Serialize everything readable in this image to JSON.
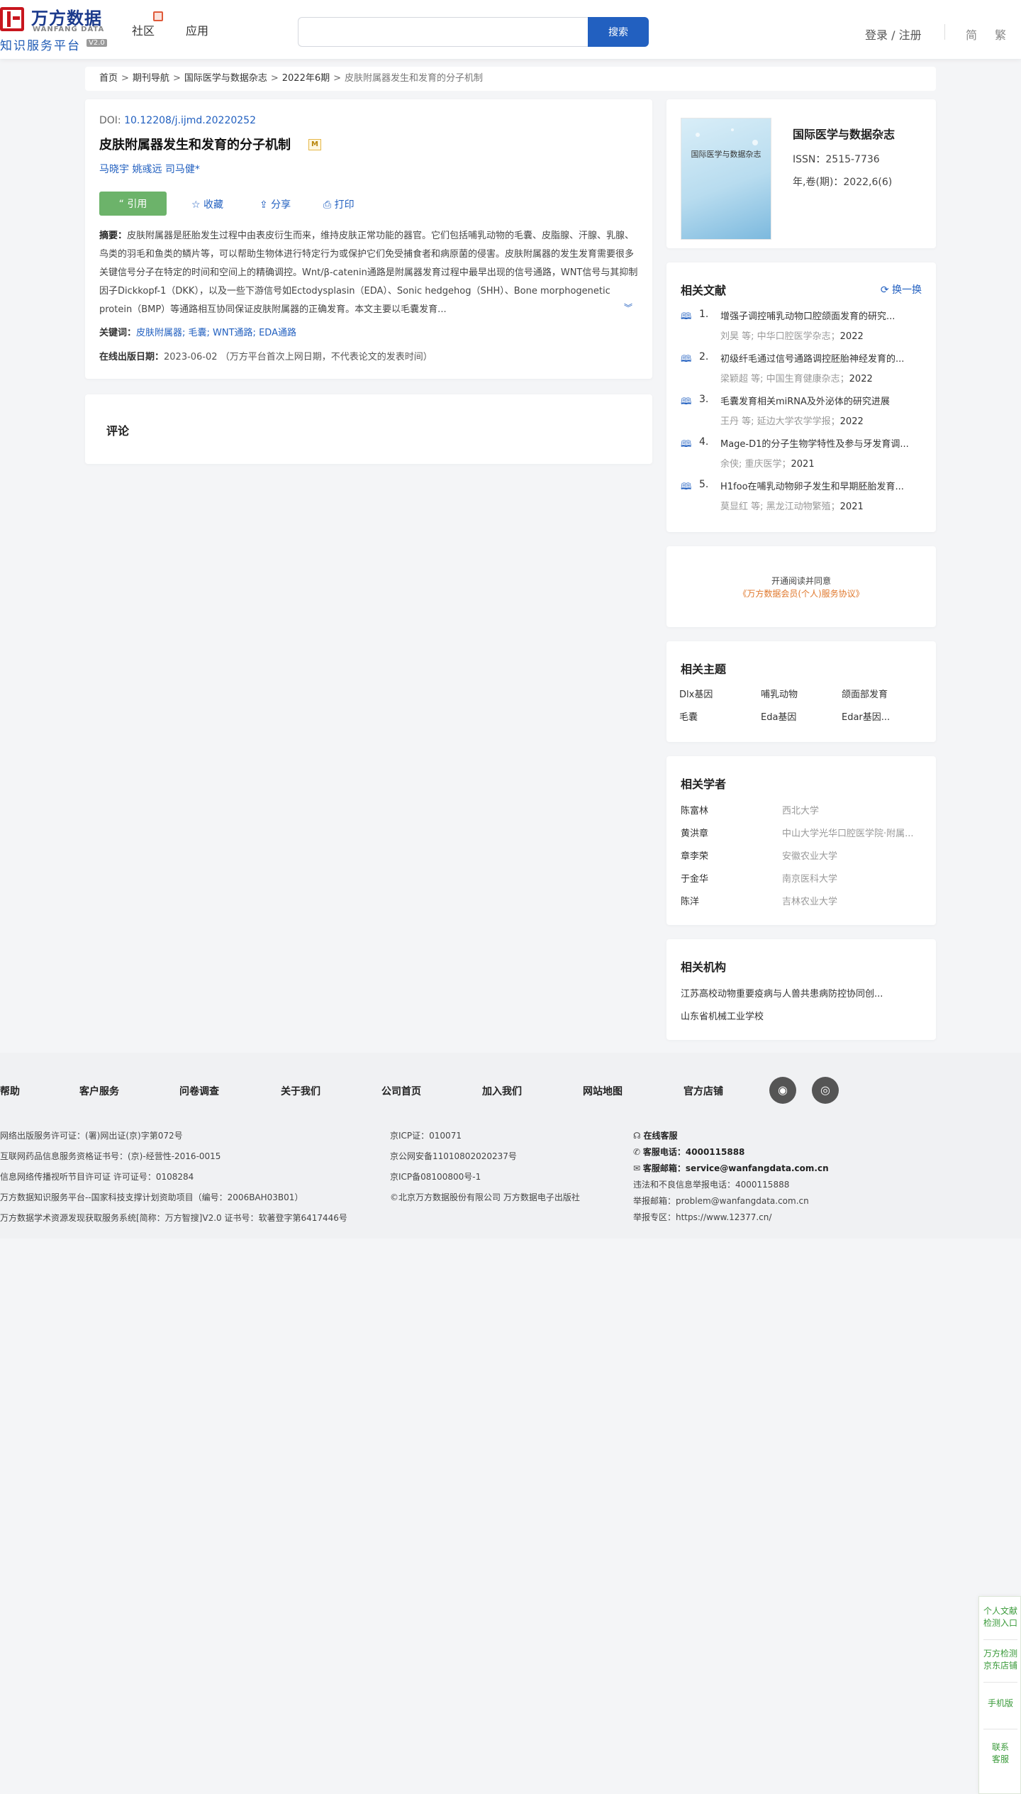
{
  "header": {
    "logo_cn": "万方数据",
    "logo_en": "WANFANG DATA",
    "logo_sub": "知识服务平台",
    "logo_version": "V2.0",
    "nav": [
      "社区",
      "应用"
    ],
    "search_placeholder": "",
    "search_button": "搜索",
    "login": "登录 / 注册",
    "lang_simplified": "简",
    "lang_traditional": "繁"
  },
  "breadcrumb": [
    "首页",
    "期刊导航",
    "国际医学与数据杂志",
    "2022年6期",
    "皮肤附属器发生和发育的分子机制"
  ],
  "article": {
    "doi_label": "DOI:",
    "doi": "10.12208/j.ijmd.20220252",
    "title": "皮肤附属器发生和发育的分子机制",
    "badge": "M",
    "authors": [
      "马晓宇",
      "姚彧远",
      "司马健*"
    ],
    "actions": {
      "cite": "“ 引用",
      "collect": "☆ 收藏",
      "share": "⇪ 分享",
      "print": "⎙ 打印"
    },
    "abstract_label": "摘要：",
    "abstract": "皮肤附属器是胚胎发生过程中由表皮衍生而来，维持皮肤正常功能的器官。它们包括哺乳动物的毛囊、皮脂腺、汗腺、乳腺、鸟类的羽毛和鱼类的鳞片等，可以帮助生物体进行特定行为或保护它们免受捕食者和病原菌的侵害。皮肤附属器的发生发育需要很多关键信号分子在特定的时间和空间上的精确调控。Wnt/β-catenin通路是附属器发育过程中最早出现的信号通路，WNT信号与其抑制因子Dickkopf-1（DKK），以及一些下游信号如Ectodysplasin（EDA）、Sonic hedgehog（SHH）、Bone morphogenetic protein（BMP）等通路相互协同保证皮肤附属器的正确发育。本文主要以毛囊发育...",
    "keywords_label": "关键词：",
    "keywords": "皮肤附属器; 毛囊; WNT通路; EDA通路",
    "pubdate_label": "在线出版日期：",
    "pubdate": "2023-06-02  （万方平台首次上网日期，不代表论文的发表时间）"
  },
  "comment": {
    "title": "评论"
  },
  "journal": {
    "cover_title": "国际医学与数据杂志",
    "name": "国际医学与数据杂志",
    "issn": "ISSN：2515-7736",
    "volume": "年,卷(期)：2022,6(6)"
  },
  "related_docs": {
    "title": "相关文献",
    "swap": "换一换",
    "items": [
      {
        "num": "1.",
        "title": "增强子调控哺乳动物口腔颌面发育的研究...",
        "authors": "刘昊  等;  中华口腔医学杂志；",
        "year": "2022"
      },
      {
        "num": "2.",
        "title": "初级纤毛通过信号通路调控胚胎神经发育的...",
        "authors": "梁颖超  等;  中国生育健康杂志；",
        "year": "2022"
      },
      {
        "num": "3.",
        "title": "毛囊发育相关miRNA及外泌体的研究进展",
        "authors": "王丹  等;  延边大学农学学报；",
        "year": "2022"
      },
      {
        "num": "4.",
        "title": "Mage-D1的分子生物学特性及参与牙发育调...",
        "authors": "余侠; 重庆医学；",
        "year": "2021"
      },
      {
        "num": "5.",
        "title": "H1foo在哺乳动物卵子发生和早期胚胎发育...",
        "authors": "莫显红  等;  黑龙江动物繁殖；",
        "year": "2021"
      }
    ]
  },
  "open_read": {
    "line1": "开通阅读并同意",
    "line2": "《万方数据会员(个人)服务协议》"
  },
  "topics": {
    "title": "相关主题",
    "items": [
      "Dlx基因",
      "哺乳动物",
      "颌面部发育",
      "毛囊",
      "Eda基因",
      "Edar基因..."
    ]
  },
  "scholars": {
    "title": "相关学者",
    "items": [
      {
        "name": "陈富林",
        "org": "西北大学"
      },
      {
        "name": "黄洪章",
        "org": "中山大学光华口腔医学院·附属..."
      },
      {
        "name": "章李荣",
        "org": "安徽农业大学"
      },
      {
        "name": "于金华",
        "org": "南京医科大学"
      },
      {
        "name": "陈洋",
        "org": "吉林农业大学"
      }
    ]
  },
  "institutions": {
    "title": "相关机构",
    "items": [
      "江苏高校动物重要疫病与人兽共患病防控协同创...",
      "山东省机械工业学校"
    ]
  },
  "footer": {
    "links": [
      "帮助",
      "客户服务",
      "问卷调查",
      "关于我们",
      "公司首页",
      "加入我们",
      "网站地图",
      "官方店铺"
    ],
    "social": [
      "微博",
      "微信"
    ],
    "col1": [
      "网络出版服务许可证：(署)网出证(京)字第072号",
      "互联网药品信息服务资格证书号：(京)-经营性-2016-0015",
      "信息网络传播视听节目许可证 许可证号：0108284",
      "万方数据知识服务平台--国家科技支撑计划资助项目（编号：2006BAH03B01）",
      "万方数据学术资源发现获取服务系统[简称：万方智搜]V2.0 证书号：软著登字第6417446号"
    ],
    "col2": [
      "京ICP证：010071",
      "京公网安备11010802020237号",
      "京ICP备08100800号-1",
      "©北京万方数据股份有限公司 万方数据电子出版社"
    ],
    "online_service": "在线客服",
    "phone_label": "客服电话：",
    "phone": "4000115888",
    "email_label": "客服邮箱：",
    "email": "service@wanfangdata.com.cn",
    "report_phone": "违法和不良信息举报电话：4000115888",
    "report_email": "举报邮箱：problem@wanfangdata.com.cn",
    "report_zone": "举报专区：https://www.12377.cn/"
  },
  "float_panel": [
    "个人文献\n检测入口",
    "万方检测\n京东店铺",
    "手机版",
    "联系\n客服"
  ],
  "colors": {
    "primary": "#2260c0",
    "green": "#6cb36a",
    "logo_red": "#c8161e"
  }
}
